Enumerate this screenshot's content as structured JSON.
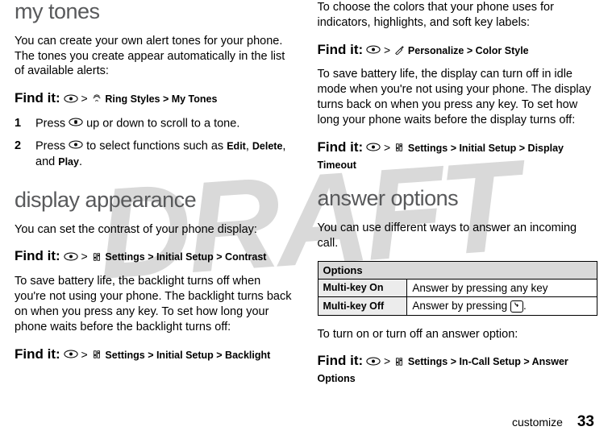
{
  "watermark": "DRAFT",
  "left": {
    "h1a": "my tones",
    "p1": "You can create your own alert tones for your phone. The tones you create appear automatically in the list of available alerts:",
    "find1_label": "Find it:",
    "find1_path": " Ring Styles > My Tones",
    "step1_num": "1",
    "step1_txt_a": "Press ",
    "step1_txt_b": " up or down to scroll to a tone.",
    "step2_num": "2",
    "step2_txt_a": "Press ",
    "step2_txt_b": " to select functions such as ",
    "step2_edit": "Edit",
    "step2_c": ", ",
    "step2_delete": "Delete",
    "step2_d": ", and ",
    "step2_play": "Play",
    "step2_e": ".",
    "h1b": "display appearance",
    "p2": "You can set the contrast of your phone display:",
    "find2_label": "Find it:",
    "find2_path": " Settings > Initial Setup > Contrast",
    "p3": "To save battery life, the backlight turns off when you're not using your phone. The backlight turns back on when you press any key. To set how long your phone waits before the backlight turns off:",
    "find3_label": "Find it:",
    "find3_path": " Settings > Initial Setup > Backlight"
  },
  "right": {
    "p1": "To choose the colors that your phone uses for indicators, highlights, and soft key labels:",
    "find4_label": "Find it:",
    "find4_path": " Personalize > Color Style",
    "p2": "To save battery life, the display can turn off in idle mode when you're not using your phone. The display turns back on when you press any key. To set how long your phone waits before the display turns off:",
    "find5_label": "Find it:",
    "find5_path": " Settings > Initial Setup > Display Timeout",
    "h1": "answer options",
    "p3": "You can use different ways to answer an incoming call.",
    "table_header": "Options",
    "row1_k": "Multi-key On",
    "row1_v": "Answer by pressing any key",
    "row2_k": "Multi-key Off",
    "row2_v_a": "Answer by pressing ",
    "row2_v_b": ".",
    "p4": "To turn on or turn off an answer option:",
    "find6_label": "Find it:",
    "find6_path": " Settings > In-Call Setup > Answer Options"
  },
  "footer": {
    "section": "customize",
    "page": "33"
  }
}
